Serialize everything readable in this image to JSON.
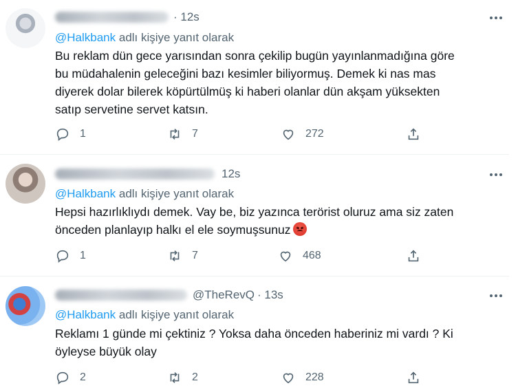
{
  "tweets": [
    {
      "handle": "",
      "time": "· 12s",
      "reply_prefix": "@Halkbank",
      "reply_suffix": " adlı kişiye yanıt olarak",
      "text": "Bu reklam dün gece yarısından sonra çekilip bugün yayınlanmadığına göre\nbu müdahalenin geleceğini bazı kesimler biliyormuş. Demek ki nas mas\ndiyerek dolar bilerek köpürtülmüş ki haberi olanlar dün akşam yüksekten\nsatıp servetine servet katsın.",
      "replies": "1",
      "retweets": "7",
      "likes": "272",
      "emoji": ""
    },
    {
      "handle": "",
      "time": "12s",
      "reply_prefix": "@Halkbank",
      "reply_suffix": " adlı kişiye yanıt olarak",
      "text": "Hepsi hazırlıklıydı demek. Vay be, biz yazınca terörist oluruz ama siz zaten\nönceden planlayıp halkı el ele soymuşsunuz",
      "replies": "1",
      "retweets": "7",
      "likes": "468",
      "emoji": "angry-face"
    },
    {
      "handle": "@TheRevQ",
      "time": "· 13s",
      "reply_prefix": "@Halkbank",
      "reply_suffix": " adlı kişiye yanıt olarak",
      "text": "Reklamı 1 günde mi çektiniz ? Yoksa daha önceden haberiniz mi vardı ? Ki\nöyleyse büyük olay",
      "replies": "2",
      "retweets": "2",
      "likes": "228",
      "emoji": ""
    }
  ],
  "icons": {
    "reply": "reply-icon",
    "retweet": "retweet-icon",
    "like": "heart-icon",
    "share": "share-icon",
    "more": "more-icon"
  },
  "colors": {
    "link": "#1d9bf0",
    "secondary": "#536471",
    "text": "#0f1419"
  }
}
